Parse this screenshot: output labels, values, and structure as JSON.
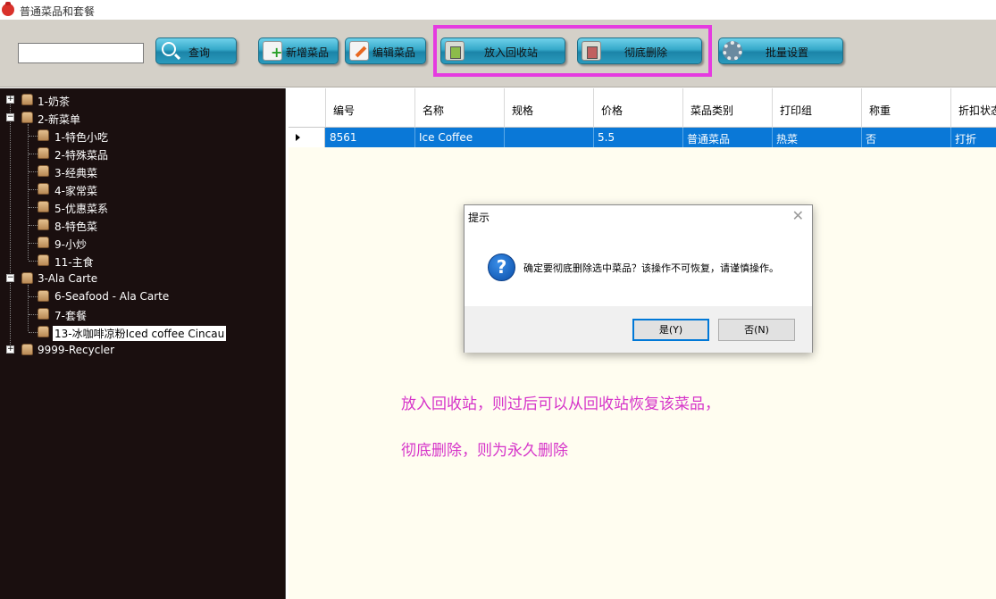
{
  "window": {
    "title": "普通菜品和套餐"
  },
  "toolbar": {
    "search_value": "",
    "query_label": "查询",
    "add_label": "新增菜品",
    "edit_label": "编辑菜品",
    "recycle_label": "放入回收站",
    "delete_label": "彻底删除",
    "batch_label": "批量设置",
    "highlight_color": "#e53be0"
  },
  "tree": {
    "items": [
      {
        "label": "1-奶茶",
        "expander": "+"
      },
      {
        "label": "2-新菜单",
        "expander": "−"
      },
      {
        "label": "1-特色小吃"
      },
      {
        "label": "2-特殊菜品"
      },
      {
        "label": "3-经典菜"
      },
      {
        "label": "4-家常菜"
      },
      {
        "label": "5-优惠菜系"
      },
      {
        "label": "8-特色菜"
      },
      {
        "label": "9-小炒"
      },
      {
        "label": "11-主食"
      },
      {
        "label": "3-Ala Carte",
        "expander": "−"
      },
      {
        "label": "6-Seafood - Ala Carte"
      },
      {
        "label": "7-套餐"
      },
      {
        "label": "13-冰咖啡凉粉Iced coffee Cincau",
        "selected": true
      },
      {
        "label": "9999-Recycler",
        "expander": "+"
      }
    ]
  },
  "grid": {
    "columns": [
      "编号",
      "名称",
      "规格",
      "价格",
      "菜品类别",
      "打印组",
      "称重",
      "折扣状态"
    ],
    "rows": [
      [
        "8561",
        "Ice Coffee",
        "",
        "5.5",
        "普通菜品",
        "热菜",
        "否",
        "打折"
      ]
    ],
    "selected_row_color": "#0a78d7"
  },
  "notes": {
    "line1": "放入回收站，则过后可以从回收站恢复该菜品，",
    "line2": "彻底删除，则为永久删除",
    "color": "#d634c9"
  },
  "dialog": {
    "title": "提示",
    "icon": "question-icon",
    "message": "确定要彻底删除选中菜品？该操作不可恢复，请谨慎操作。",
    "yes_label": "是(Y)",
    "no_label": "否(N)"
  }
}
